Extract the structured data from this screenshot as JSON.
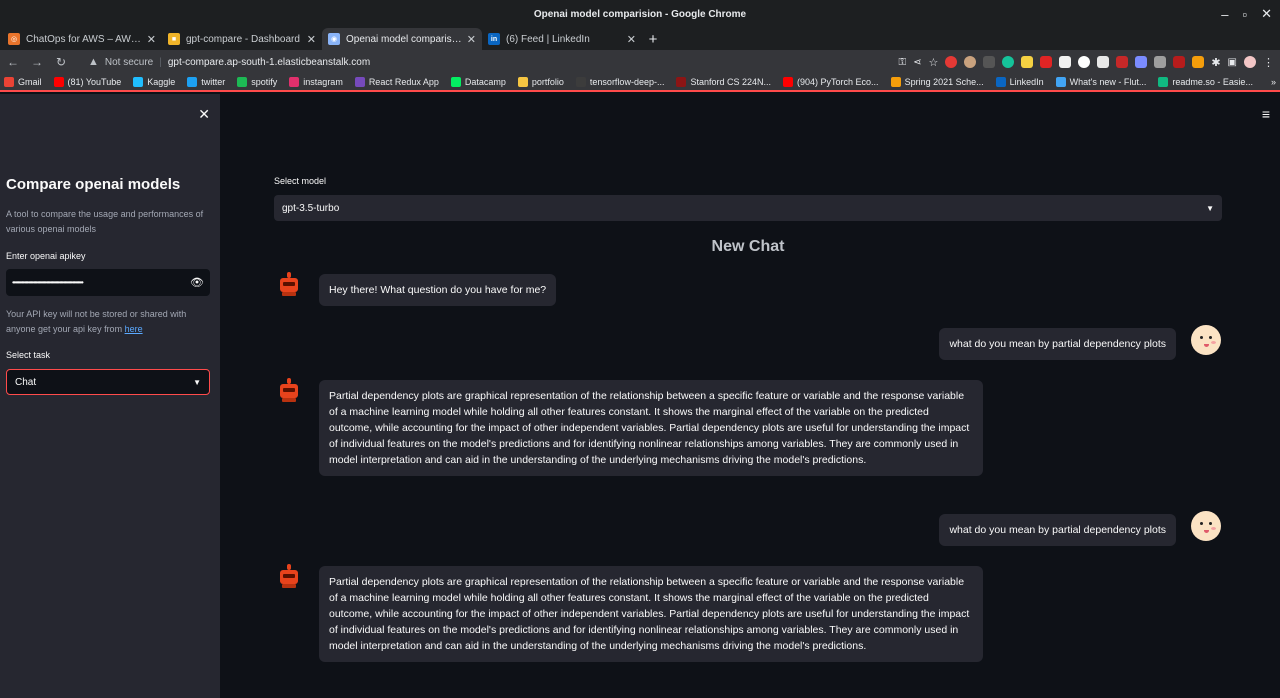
{
  "window": {
    "title": "Openai model comparision - Google Chrome"
  },
  "tabs": [
    {
      "label": "ChatOps for AWS – AWS Chatb",
      "icon": "aws-icon",
      "color": "#e8742c",
      "active": false
    },
    {
      "label": "gpt-compare - Dashboard",
      "icon": "package-icon",
      "color": "#f0b429",
      "active": false
    },
    {
      "label": "Openai model comparision",
      "icon": "globe-icon",
      "color": "#8ab4f8",
      "active": true
    },
    {
      "label": "(6) Feed | LinkedIn",
      "icon": "linkedin-icon",
      "color": "#0a66c2",
      "active": false
    }
  ],
  "address": {
    "security": "Not secure",
    "url": "gpt-compare.ap-south-1.elasticbeanstalk.com"
  },
  "bookmarks": [
    {
      "label": "Gmail",
      "color": "#ea4335"
    },
    {
      "label": "(81) YouTube",
      "color": "#ff0000"
    },
    {
      "label": "Kaggle",
      "color": "#20beff"
    },
    {
      "label": "twitter",
      "color": "#1da1f2"
    },
    {
      "label": "spotify",
      "color": "#1db954"
    },
    {
      "label": "instagram",
      "color": "#e1306c"
    },
    {
      "label": "React Redux App",
      "color": "#764abc"
    },
    {
      "label": "Datacamp",
      "color": "#03ef62"
    },
    {
      "label": "portfolio",
      "color": "#f5c542"
    },
    {
      "label": "tensorflow-deep-...",
      "color": "#3c3c3c"
    },
    {
      "label": "Stanford CS 224N...",
      "color": "#8c1515"
    },
    {
      "label": "(904) PyTorch Eco...",
      "color": "#ff0000"
    },
    {
      "label": "Spring 2021 Sche...",
      "color": "#f59e0b"
    },
    {
      "label": "LinkedIn",
      "color": "#0a66c2"
    },
    {
      "label": "What's new - Flut...",
      "color": "#42a5f5"
    },
    {
      "label": "readme.so - Easie...",
      "color": "#10b981"
    }
  ],
  "sidebar": {
    "title": "Compare openai models",
    "description": "A tool to compare the usage and performances of various openai models",
    "apikey_label": "Enter openai apikey",
    "apikey_mask": "••••••••••••••••••••••••••••••••••••••••••••••••••••••",
    "note_text": "Your API key will not be stored or shared with anyone get your api key from ",
    "note_link": "here",
    "task_label": "Select task",
    "task_value": "Chat"
  },
  "main": {
    "model_label": "Select model",
    "model_value": "gpt-3.5-turbo",
    "chat_title": "New Chat"
  },
  "messages": [
    {
      "role": "bot",
      "text": "Hey there! What question do you have for me?"
    },
    {
      "role": "user",
      "text": "what do you mean by partial dependency plots"
    },
    {
      "role": "bot",
      "text": "Partial dependency plots are graphical representation of the relationship between a specific feature or variable and the response variable of a machine learning model while holding all other features constant. It shows the marginal effect of the variable on the predicted outcome, while accounting for the impact of other independent variables. Partial dependency plots are useful for understanding the impact of individual features on the model's predictions and for identifying nonlinear relationships among variables. They are commonly used in model interpretation and can aid in the understanding of the underlying mechanisms driving the model's predictions."
    },
    {
      "role": "user",
      "text": "what do you mean by partial dependency plots"
    },
    {
      "role": "bot",
      "text": "Partial dependency plots are graphical representation of the relationship between a specific feature or variable and the response variable of a machine learning model while holding all other features constant. It shows the marginal effect of the variable on the predicted outcome, while accounting for the impact of other independent variables. Partial dependency plots are useful for understanding the impact of individual features on the model's predictions and for identifying nonlinear relationships among variables. They are commonly used in model interpretation and can aid in the understanding of the underlying mechanisms driving the model's predictions."
    }
  ]
}
